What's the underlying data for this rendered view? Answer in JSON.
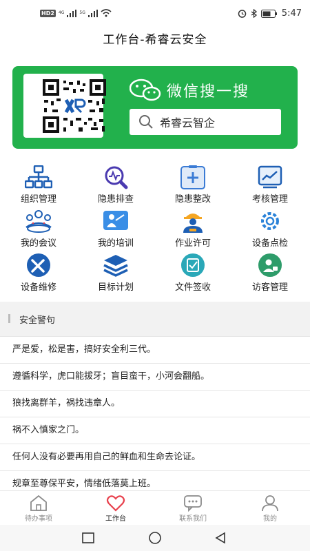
{
  "status_bar": {
    "hd": "HD",
    "hd_num": "2",
    "sig1": "4G",
    "sig2": "5G",
    "time": "5:47"
  },
  "header": {
    "title": "工作台-希睿云安全"
  },
  "banner": {
    "wechat_label": "微信搜一搜",
    "search_text": "希睿云智企",
    "color": "#22b14c"
  },
  "grid": [
    {
      "label": "组织管理",
      "icon": "org-chart-icon"
    },
    {
      "label": "隐患排查",
      "icon": "hazard-inspect-icon"
    },
    {
      "label": "隐患整改",
      "icon": "hazard-fix-icon"
    },
    {
      "label": "考核管理",
      "icon": "assessment-icon"
    },
    {
      "label": "我的会议",
      "icon": "meeting-icon"
    },
    {
      "label": "我的培训",
      "icon": "training-icon"
    },
    {
      "label": "作业许可",
      "icon": "work-permit-icon"
    },
    {
      "label": "设备点检",
      "icon": "equipment-check-icon"
    },
    {
      "label": "设备维修",
      "icon": "equipment-repair-icon"
    },
    {
      "label": "目标计划",
      "icon": "target-plan-icon"
    },
    {
      "label": "文件签收",
      "icon": "file-sign-icon"
    },
    {
      "label": "访客管理",
      "icon": "visitor-icon"
    }
  ],
  "section": {
    "title": "安全警句"
  },
  "slogans": [
    "严是爱，松是害，搞好安全利三代。",
    "遵循科学，虎口能拔牙；盲目蛮干，小河会翻船。",
    "狼找离群羊，祸找违章人。",
    "祸不入慎家之门。",
    "任何人没有必要再用自己的鲜血和生命去论证。",
    "规章至尊保平安，情绪低落莫上班。"
  ],
  "tabs": [
    {
      "label": "待办事项",
      "icon": "home-icon",
      "active": false
    },
    {
      "label": "工作台",
      "icon": "heart-icon",
      "active": true
    },
    {
      "label": "联系我们",
      "icon": "chat-icon",
      "active": false
    },
    {
      "label": "我的",
      "icon": "user-icon",
      "active": false
    }
  ],
  "colors": {
    "accent": "#e8414d",
    "green": "#22b14c",
    "blue": "#1e5fb4"
  }
}
